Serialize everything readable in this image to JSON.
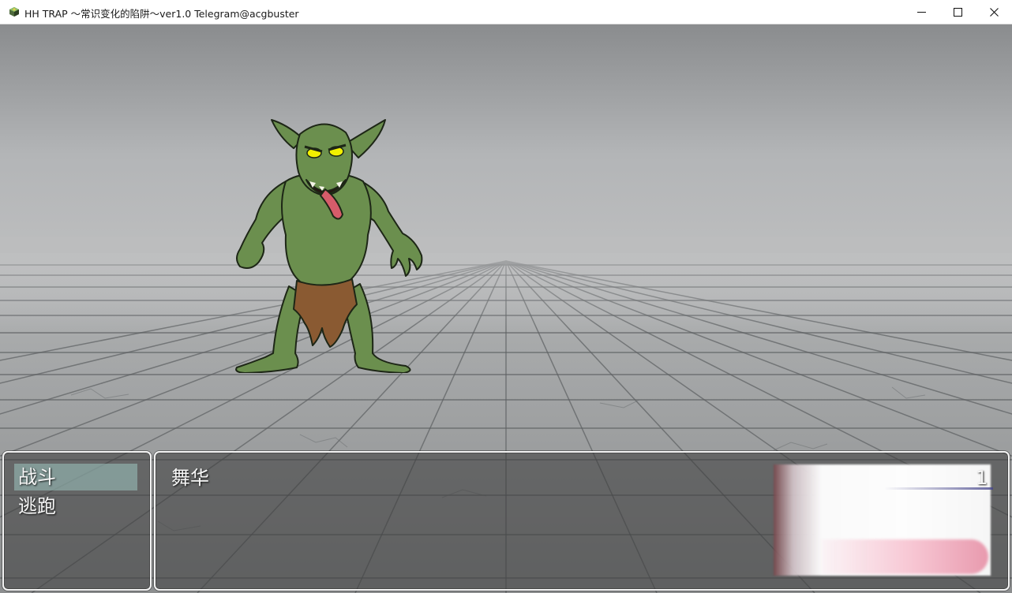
{
  "window": {
    "title": "HH TRAP ～常识变化的陷阱～ver1.0 Telegram@acgbuster",
    "icon": "app-icon",
    "controls": [
      "minimize-icon",
      "maximize-icon",
      "close-icon"
    ]
  },
  "battle": {
    "enemy": {
      "sprite": "goblin-enemy"
    },
    "commands": [
      {
        "label": "战斗",
        "selected": true
      },
      {
        "label": "逃跑",
        "selected": false
      }
    ],
    "party": [
      {
        "name": "舞华",
        "level_value": "1"
      }
    ]
  },
  "colors": {
    "window_border": "#f3f3f3",
    "window_fill": "#3a3a3a",
    "selection": "#96b9b4",
    "goblin_skin": "#6b8f4e",
    "goblin_eyes": "#f2f000",
    "loincloth": "#8a5a32",
    "portrait_bar": "#f7c6d3"
  }
}
